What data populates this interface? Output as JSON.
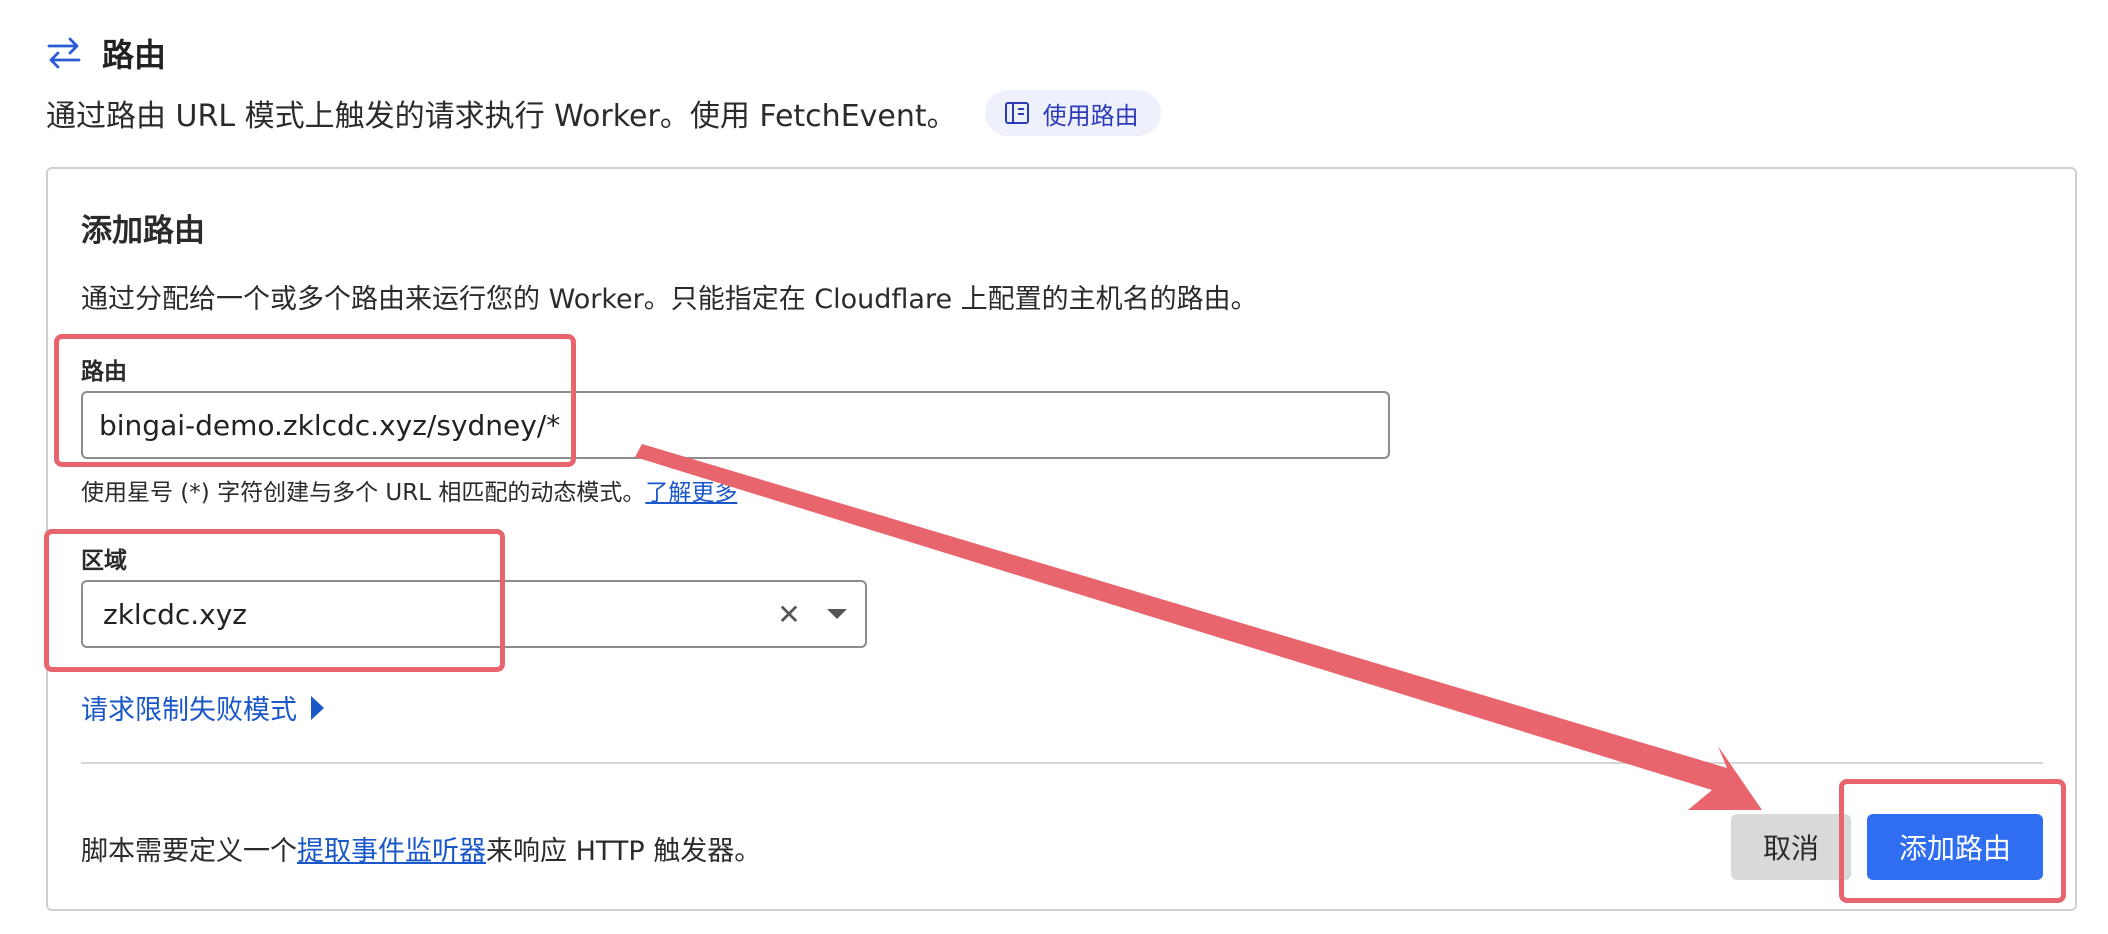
{
  "header": {
    "icon": "swap-arrows-icon",
    "title": "路由",
    "description": "通过路由 URL 模式上触发的请求执行 Worker。使用 FetchEvent。",
    "docs_link": {
      "icon": "book-icon",
      "label": "使用路由"
    }
  },
  "card": {
    "title": "添加路由",
    "description": "通过分配给一个或多个路由来运行您的 Worker。只能指定在 Cloudflare 上配置的主机名的路由。",
    "route_field": {
      "label": "路由",
      "value": "bingai-demo.zklcdc.xyz/sydney/*",
      "help_text": "使用星号 (*) 字符创建与多个 URL 相匹配的动态模式。",
      "help_link": "了解更多"
    },
    "zone_field": {
      "label": "区域",
      "value": "zklcdc.xyz",
      "clear_icon": "close-icon",
      "dropdown_icon": "caret-down-icon"
    },
    "fail_mode_toggle": {
      "label": "请求限制失败模式",
      "icon": "caret-right-icon"
    },
    "footer": {
      "note_prefix": "脚本需要定义一个",
      "note_link": "提取事件监听器",
      "note_suffix": "来响应 HTTP 触发器。"
    },
    "buttons": {
      "cancel": "取消",
      "add": "添加路由"
    }
  },
  "colors": {
    "accent": "#2f6ef0",
    "link": "#1a58c9",
    "annotation": "#e8656d",
    "pill_bg": "#eef0fb"
  }
}
